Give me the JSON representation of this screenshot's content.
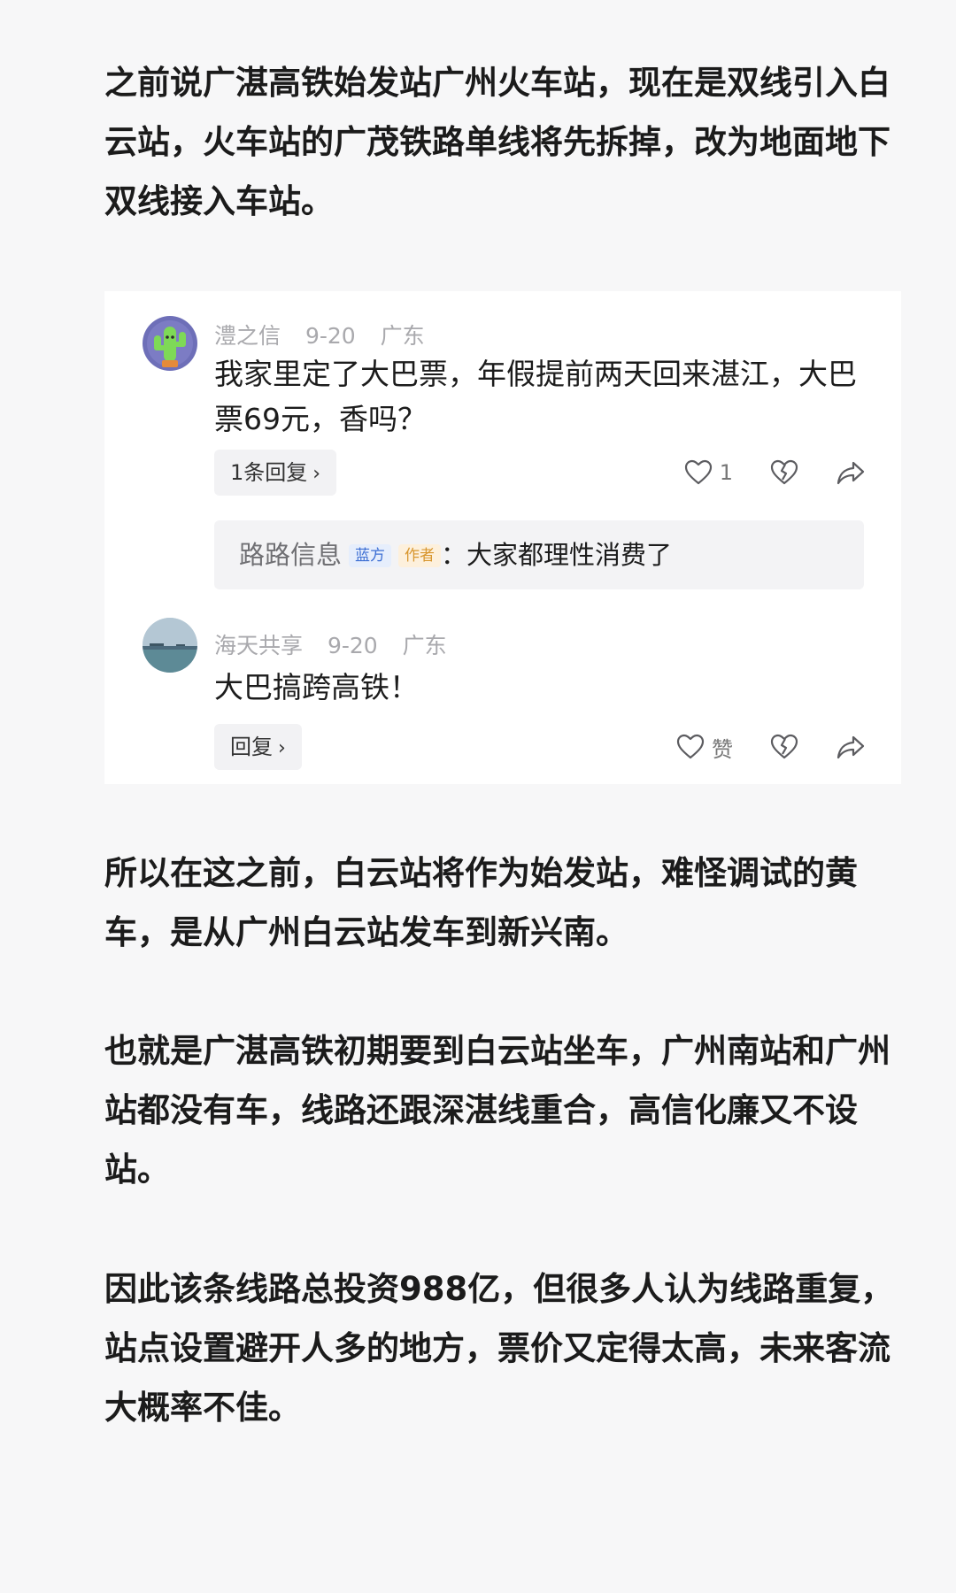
{
  "paragraphs": [
    "之前说广湛高铁始发站广州火车站，现在是双线引入白云站，火车站的广茂铁路单线将先拆掉，改为地面地下双线接入车站。",
    "所以在这之前，白云站将作为始发站，难怪调试的黄车，是从广州白云站发车到新兴南。",
    "也就是广湛高铁初期要到白云站坐车，广州南站和广州站都没有车，线路还跟深湛线重合，高信化廉又不设站。",
    "因此该条线路总投资988亿，但很多人认为线路重复，站点设置避开人多的地方，票价又定得太高，未来客流大概率不佳。"
  ],
  "comments": [
    {
      "user": "澧之信",
      "date": "9-20",
      "location": "广东",
      "avatar_icon": "cactus-avatar",
      "text": "我家里定了大巴票，年假提前两天回来湛江，大巴票69元，香吗？",
      "reply_label": "1条回复",
      "like_count": "1",
      "sub_reply": {
        "author": "路路信息",
        "badge_blue": "蓝方",
        "badge_author": "作者",
        "text": "：大家都理性消费了"
      }
    },
    {
      "user": "海天共享",
      "date": "9-20",
      "location": "广东",
      "avatar_icon": "seascape-avatar",
      "text": "大巴搞跨高铁！",
      "reply_label": "回复",
      "like_label": "赞"
    }
  ],
  "colors": {
    "background": "#f7f7f8",
    "card": "#ffffff",
    "meta_text": "#a9a9ad",
    "badge_blue": "#3d6fd3",
    "badge_orange": "#d8962e"
  }
}
